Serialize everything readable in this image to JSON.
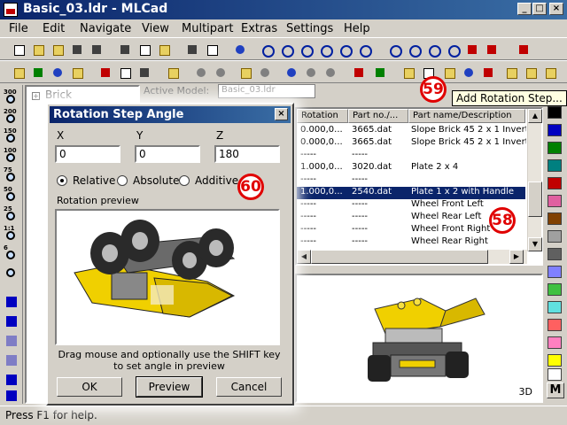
{
  "window": {
    "title": "Basic_03.ldr - MLCad"
  },
  "menu": [
    "File",
    "Edit",
    "Navigate",
    "View",
    "Multipart",
    "Extras",
    "Settings",
    "Help"
  ],
  "left_toolbar": {
    "zoom_labels": [
      "300",
      "200",
      "150",
      "100",
      "75",
      "50",
      "25",
      "1:1",
      "6"
    ]
  },
  "tree": {
    "root_label": "Brick"
  },
  "active_model": {
    "label": "Active Model:",
    "value": "Basic_03.ldr"
  },
  "tooltip": {
    "text": "Add Rotation Step..."
  },
  "listview": {
    "columns": [
      "Rotation",
      "Part no./...",
      "Part name/Description"
    ],
    "rows": [
      {
        "rotation": "0.000,0...",
        "part_no": "3665.dat",
        "name": "Slope Brick 45  2 x  1 Inverted",
        "selected": false
      },
      {
        "rotation": "0.000,0...",
        "part_no": "3665.dat",
        "name": "Slope Brick 45  2 x  1 Inverted",
        "selected": false
      },
      {
        "rotation": "-----",
        "part_no": "-----",
        "name": "",
        "selected": false
      },
      {
        "rotation": "1.000,0...",
        "part_no": "3020.dat",
        "name": "Plate  2 x  4",
        "selected": false
      },
      {
        "rotation": "-----",
        "part_no": "-----",
        "name": "",
        "selected": false
      },
      {
        "rotation": "1.000,0...",
        "part_no": "2540.dat",
        "name": "Plate  1 x  2 with Handle",
        "selected": true
      },
      {
        "rotation": "-----",
        "part_no": "-----",
        "name": "Wheel Front Left",
        "selected": false
      },
      {
        "rotation": "-----",
        "part_no": "-----",
        "name": "Wheel Rear Left",
        "selected": false
      },
      {
        "rotation": "-----",
        "part_no": "-----",
        "name": "Wheel Front Right",
        "selected": false
      },
      {
        "rotation": "-----",
        "part_no": "-----",
        "name": "Wheel Rear Right",
        "selected": false
      }
    ]
  },
  "view3d": {
    "label": "3D"
  },
  "palette": {
    "colors": [
      "#000000",
      "#0000c0",
      "#008000",
      "#008080",
      "#c00000",
      "#e060a0",
      "#804000",
      "#a0a0a0",
      "#606060",
      "#8080ff",
      "#40c040",
      "#60e0e0",
      "#ff6060",
      "#ff80c0",
      "#ffff00",
      "#ffffff"
    ],
    "mode_button": "M"
  },
  "dialog": {
    "title": "Rotation Step Angle",
    "x_label": "X",
    "y_label": "Y",
    "z_label": "Z",
    "x_value": "0",
    "y_value": "0",
    "z_value": "180",
    "modes": [
      "Relative",
      "Absolute",
      "Additive"
    ],
    "selected_mode": "Relative",
    "preview_label": "Rotation preview",
    "hint": "Drag mouse and optionally use the SHIFT key to set angle in preview",
    "buttons": {
      "ok": "OK",
      "preview": "Preview",
      "cancel": "Cancel"
    }
  },
  "callouts": {
    "c58": "58",
    "c59": "59",
    "c60": "60"
  },
  "status": {
    "text": "Press F1 for help."
  }
}
